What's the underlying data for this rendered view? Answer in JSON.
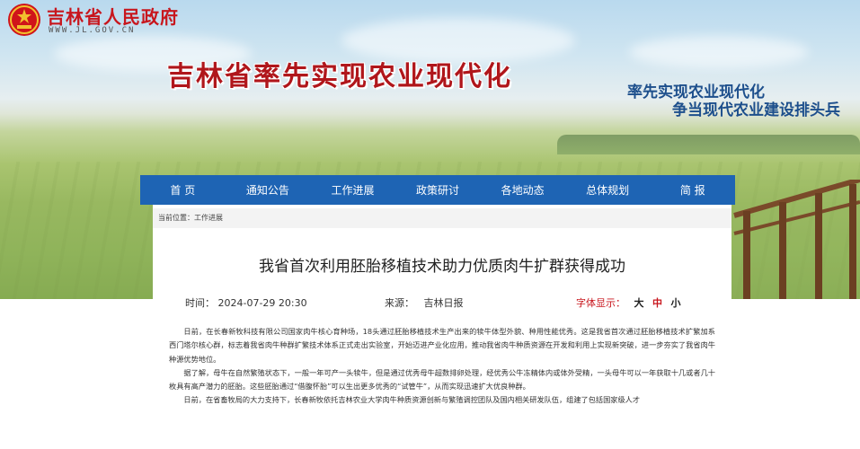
{
  "header": {
    "site_name": "吉林省人民政府",
    "site_url": "WWW.JL.GOV.CN",
    "banner_title": "吉林省率先实现农业现代化",
    "slogan_line1": "率先实现农业现代化",
    "slogan_line2": "争当现代农业建设排头兵"
  },
  "nav": {
    "items": [
      {
        "label": "首  页"
      },
      {
        "label": "通知公告"
      },
      {
        "label": "工作进展"
      },
      {
        "label": "政策研讨"
      },
      {
        "label": "各地动态"
      },
      {
        "label": "总体规划"
      },
      {
        "label": "简  报"
      }
    ]
  },
  "breadcrumb": {
    "prefix": "当前位置：",
    "current": "工作进展"
  },
  "article": {
    "title": "我省首次利用胚胎移植技术助力优质肉牛扩群获得成功",
    "time_label": "时间：",
    "time_value": "2024-07-29 20:30",
    "source_label": "来源：",
    "source_value": "吉林日报",
    "font_label": "字体显示：",
    "font_large": "大",
    "font_medium": "中",
    "font_small": "小",
    "paragraphs": [
      "日前，在长春新牧科技有限公司国家肉牛核心育种场，18头通过胚胎移植技术生产出来的犊牛体型外貌、种用性能优秀。这是我省首次通过胚胎移植技术扩繁加系西门塔尔核心群，标志着我省肉牛种群扩繁技术体系正式走出实验室，开始迈进产业化应用，推动我省肉牛种质资源在开发和利用上实现新突破，进一步夯实了我省肉牛种源优势地位。",
      "据了解，母牛在自然繁殖状态下，一般一年可产一头犊牛，但是通过优秀母牛超数排卵处理，经优秀公牛冻精体内或体外受精，一头母牛可以一年获取十几或者几十枚具有高产潜力的胚胎。这些胚胎通过“借腹怀胎”可以生出更多优秀的“试管牛”，从而实现迅速扩大优良种群。",
      "日前，在省畜牧局的大力支持下，长春新牧依托吉林农业大学肉牛种质资源创新与繁殖调控团队及国内相关研发队伍，组建了包括国家级人才"
    ]
  }
}
